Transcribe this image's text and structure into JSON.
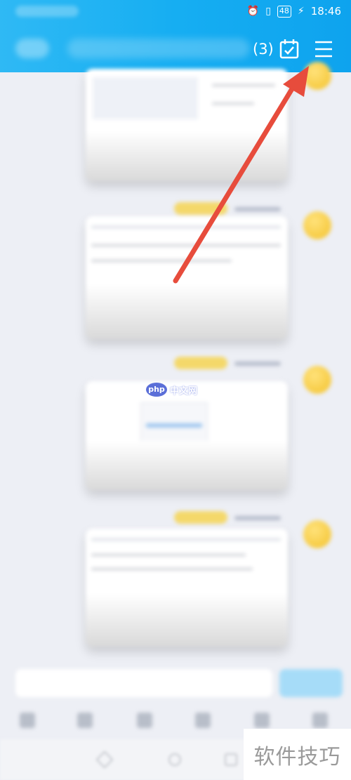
{
  "status_bar": {
    "battery": "48",
    "time": "18:46",
    "icons": [
      "alarm-icon",
      "vibrate-icon",
      "battery-icon",
      "charging-icon"
    ]
  },
  "header": {
    "title_suffix": "(3)",
    "actions": [
      "calendar-check-icon",
      "hamburger-menu-icon"
    ]
  },
  "chat": {
    "messages": [
      {
        "type": "file-preview",
        "sender_color": "#f4d86a"
      },
      {
        "type": "file-preview",
        "sender_color": "#f4d86a"
      },
      {
        "type": "file-preview",
        "sender_color": "#f4d86a"
      },
      {
        "type": "file-preview",
        "sender_color": "#f4d86a"
      }
    ]
  },
  "annotation": {
    "arrow_color": "#e74c3c",
    "target": "hamburger-menu-icon"
  },
  "overlay_logo": {
    "badge": "php",
    "text": "中文网"
  },
  "watermark": {
    "text": "软件技巧"
  },
  "colors": {
    "header": "#16aef2",
    "send_button": "#a6dcf8",
    "avatar": "#f3c12b"
  }
}
